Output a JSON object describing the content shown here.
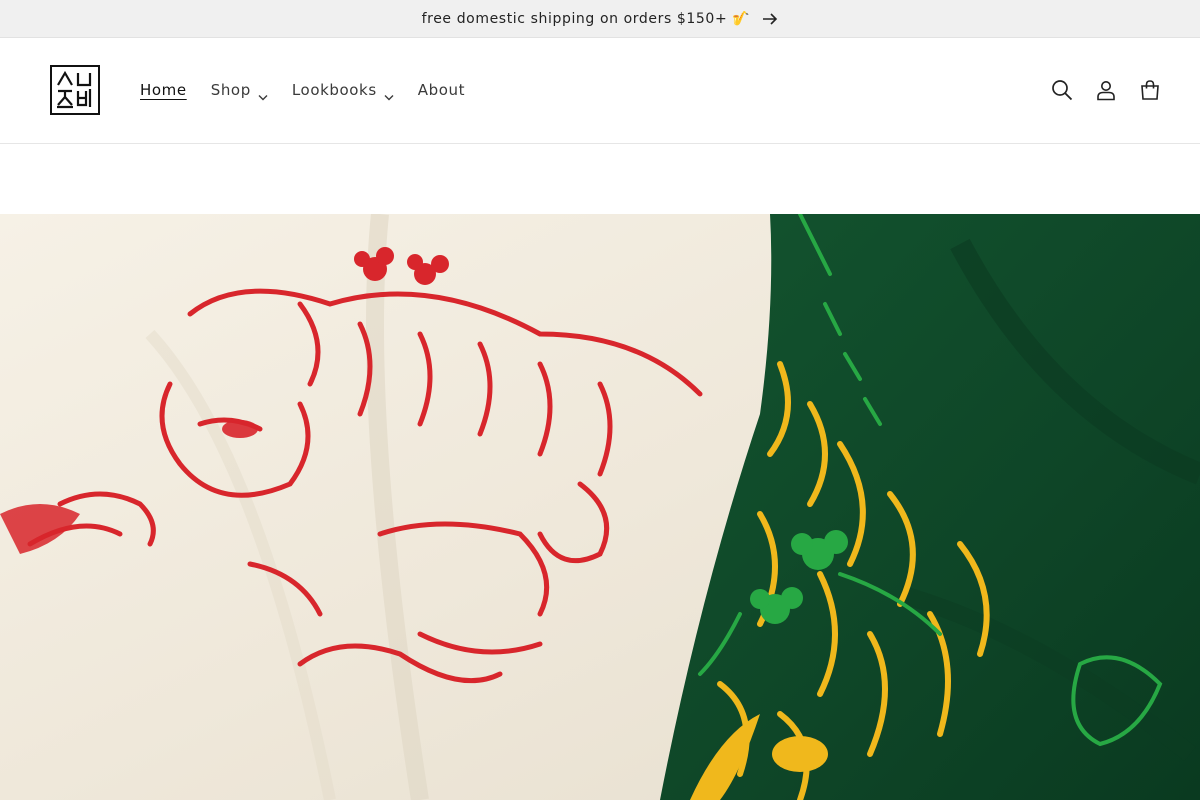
{
  "announcement": {
    "text": "free domestic shipping on orders $150+ 🎷",
    "arrow_icon": "arrow-right-icon"
  },
  "header": {
    "logo_text": "ㅅㅈ 초비",
    "nav": [
      {
        "label": "Home",
        "active": true,
        "has_dropdown": false
      },
      {
        "label": "Shop",
        "active": false,
        "has_dropdown": true
      },
      {
        "label": "Lookbooks",
        "active": false,
        "has_dropdown": true
      },
      {
        "label": "About",
        "active": false,
        "has_dropdown": false
      }
    ],
    "icons": [
      "search-icon",
      "account-icon",
      "cart-icon"
    ]
  },
  "hero": {
    "image_subject": "cream and green sweatshirts with tiger prints",
    "colors": {
      "cream": "#f2ede2",
      "red_print": "#d8262c",
      "green_fabric": "#0f4a2a",
      "yellow_print": "#f0b81c",
      "bright_green_print": "#27a844"
    }
  }
}
